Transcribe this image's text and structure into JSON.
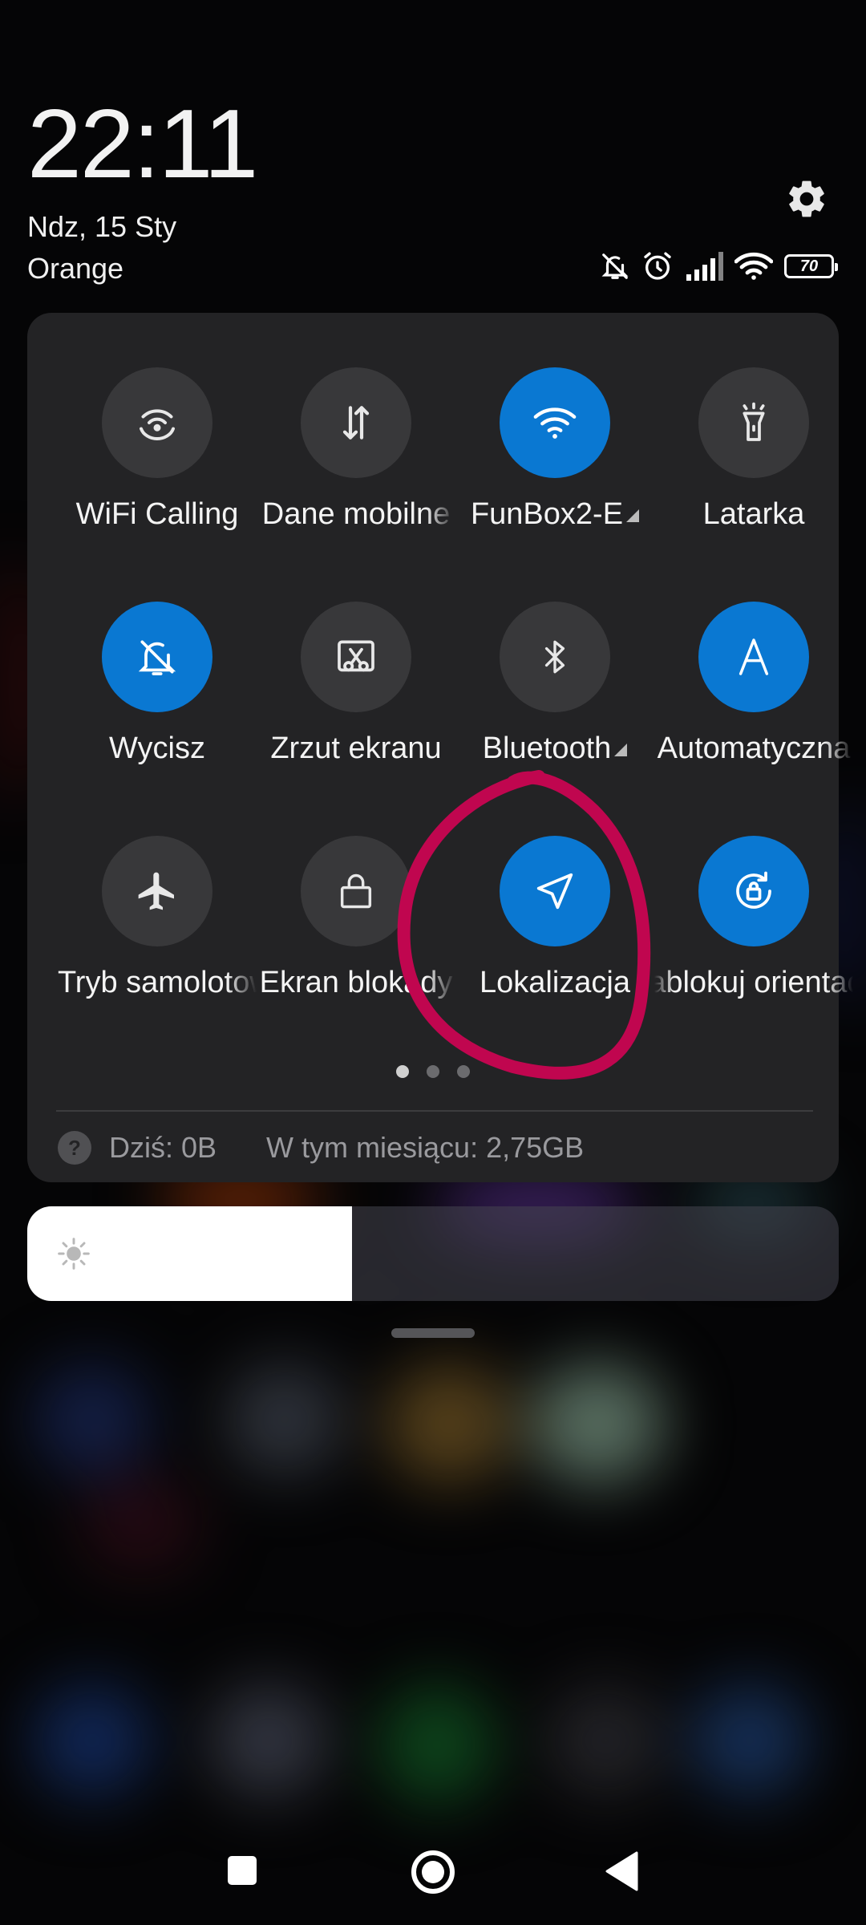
{
  "status": {
    "time": "22:11",
    "date": "Ndz, 15 Sty",
    "carrier": "Orange",
    "battery": "70",
    "icons": [
      "bell-off-icon",
      "alarm-icon",
      "signal-icon",
      "wifi-icon",
      "battery-icon"
    ]
  },
  "tiles": [
    {
      "label": "WiFi Calling",
      "icon": "wifi-calling-icon",
      "active": false
    },
    {
      "label": "Dane mobilne",
      "icon": "mobile-data-icon",
      "active": false
    },
    {
      "label": "FunBox2-E",
      "icon": "wifi-icon",
      "active": true
    },
    {
      "label": "Latarka",
      "icon": "flashlight-icon",
      "active": false
    },
    {
      "label": "Wycisz",
      "icon": "bell-off-icon",
      "active": true
    },
    {
      "label": "Zrzut ekranu",
      "icon": "screenshot-icon",
      "active": false
    },
    {
      "label": "Bluetooth",
      "icon": "bluetooth-icon",
      "active": false
    },
    {
      "label": "Automatyczna",
      "icon": "auto-brightness-icon",
      "active": true
    },
    {
      "label": "Tryb samolotowy",
      "icon": "airplane-icon",
      "active": false
    },
    {
      "label": "Ekran blokady",
      "icon": "lock-icon",
      "active": false
    },
    {
      "label": "Lokalizacja",
      "icon": "location-icon",
      "active": true
    },
    {
      "label": "Zablokuj orientację",
      "icon": "rotation-lock-icon",
      "active": true
    }
  ],
  "pager": {
    "pages": 3,
    "current": 1
  },
  "data_usage": {
    "today": "Dziś: 0B",
    "month": "W tym miesiącu: 2,75GB"
  },
  "brightness": {
    "level": 0.4
  },
  "colors": {
    "accent": "#0a78d2",
    "annotation": "#c0064f",
    "panel": "#232325"
  }
}
